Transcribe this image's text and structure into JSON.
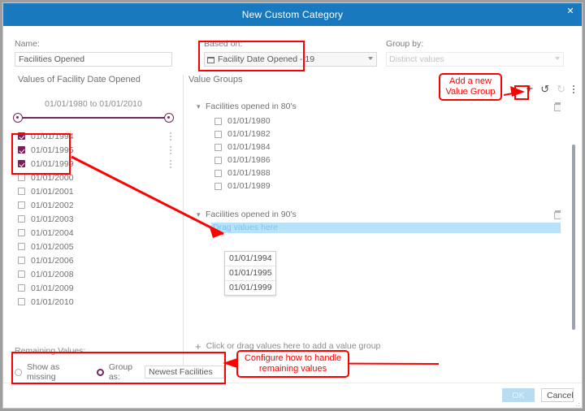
{
  "window": {
    "title": "New Custom Category",
    "close_icon": "close-icon"
  },
  "form": {
    "name_label": "Name:",
    "name_value": "Facilities Opened",
    "based_on_label": "Based on:",
    "based_on_value": "Facility Date Opened - 19",
    "based_on_icon": "calendar-icon",
    "group_by_label": "Group by:",
    "group_by_value": "Distinct values"
  },
  "left_panel": {
    "title": "Values of Facility Date Opened",
    "range_label": "01/01/1980 to 01/01/2010",
    "values": [
      {
        "label": "01/01/1994",
        "checked": true,
        "menu": true
      },
      {
        "label": "01/01/1995",
        "checked": true,
        "menu": true
      },
      {
        "label": "01/01/1999",
        "checked": true,
        "menu": true
      },
      {
        "label": "01/01/2000",
        "checked": false,
        "menu": false
      },
      {
        "label": "01/01/2001",
        "checked": false,
        "menu": false
      },
      {
        "label": "01/01/2002",
        "checked": false,
        "menu": false
      },
      {
        "label": "01/01/2003",
        "checked": false,
        "menu": false
      },
      {
        "label": "01/01/2004",
        "checked": false,
        "menu": false
      },
      {
        "label": "01/01/2005",
        "checked": false,
        "menu": false
      },
      {
        "label": "01/01/2006",
        "checked": false,
        "menu": false
      },
      {
        "label": "01/01/2008",
        "checked": false,
        "menu": false
      },
      {
        "label": "01/01/2009",
        "checked": false,
        "menu": false
      },
      {
        "label": "01/01/2010",
        "checked": false,
        "menu": false
      }
    ]
  },
  "value_groups": {
    "title": "Value Groups",
    "collapse_icon": "chevron-down-icon",
    "delete_icon": "trash-icon",
    "groups": [
      {
        "name": "Facilities opened in 80's",
        "items": [
          "01/01/1980",
          "01/01/1982",
          "01/01/1984",
          "01/01/1986",
          "01/01/1988",
          "01/01/1989"
        ],
        "drop_placeholder": null
      },
      {
        "name": "Facilities opened in 90's",
        "items": [],
        "drop_placeholder": "Drag values here"
      }
    ],
    "add_group_label": "Click or drag values here to add a value group",
    "add_group_icon": "plus-icon"
  },
  "drag_preview": {
    "items": [
      "01/01/1994",
      "01/01/1995",
      "01/01/1999"
    ]
  },
  "toolbar": {
    "add_icon": "plus-icon",
    "add_label": "+",
    "undo_icon": "undo-icon",
    "undo_label": "↺",
    "redo_icon": "redo-icon",
    "redo_label": "↻",
    "menu_icon": "kebab-menu-icon"
  },
  "remaining": {
    "header": "Remaining Values:",
    "show_as_missing_label": "Show as missing",
    "show_as_missing_selected": false,
    "group_as_label": "Group as:",
    "group_as_selected": true,
    "group_as_value": "Newest Facilities"
  },
  "footer": {
    "ok_label": "OK",
    "ok_disabled": true,
    "cancel_label": "Cancel"
  },
  "annotations": {
    "add_value_group": "Add a new\nValue Group",
    "add_value_group_line1": "Add a new",
    "add_value_group_line2": "Value Group",
    "remaining_values_line1": "Configure how to handle",
    "remaining_values_line2": "remaining values",
    "color": "#ff0000"
  }
}
